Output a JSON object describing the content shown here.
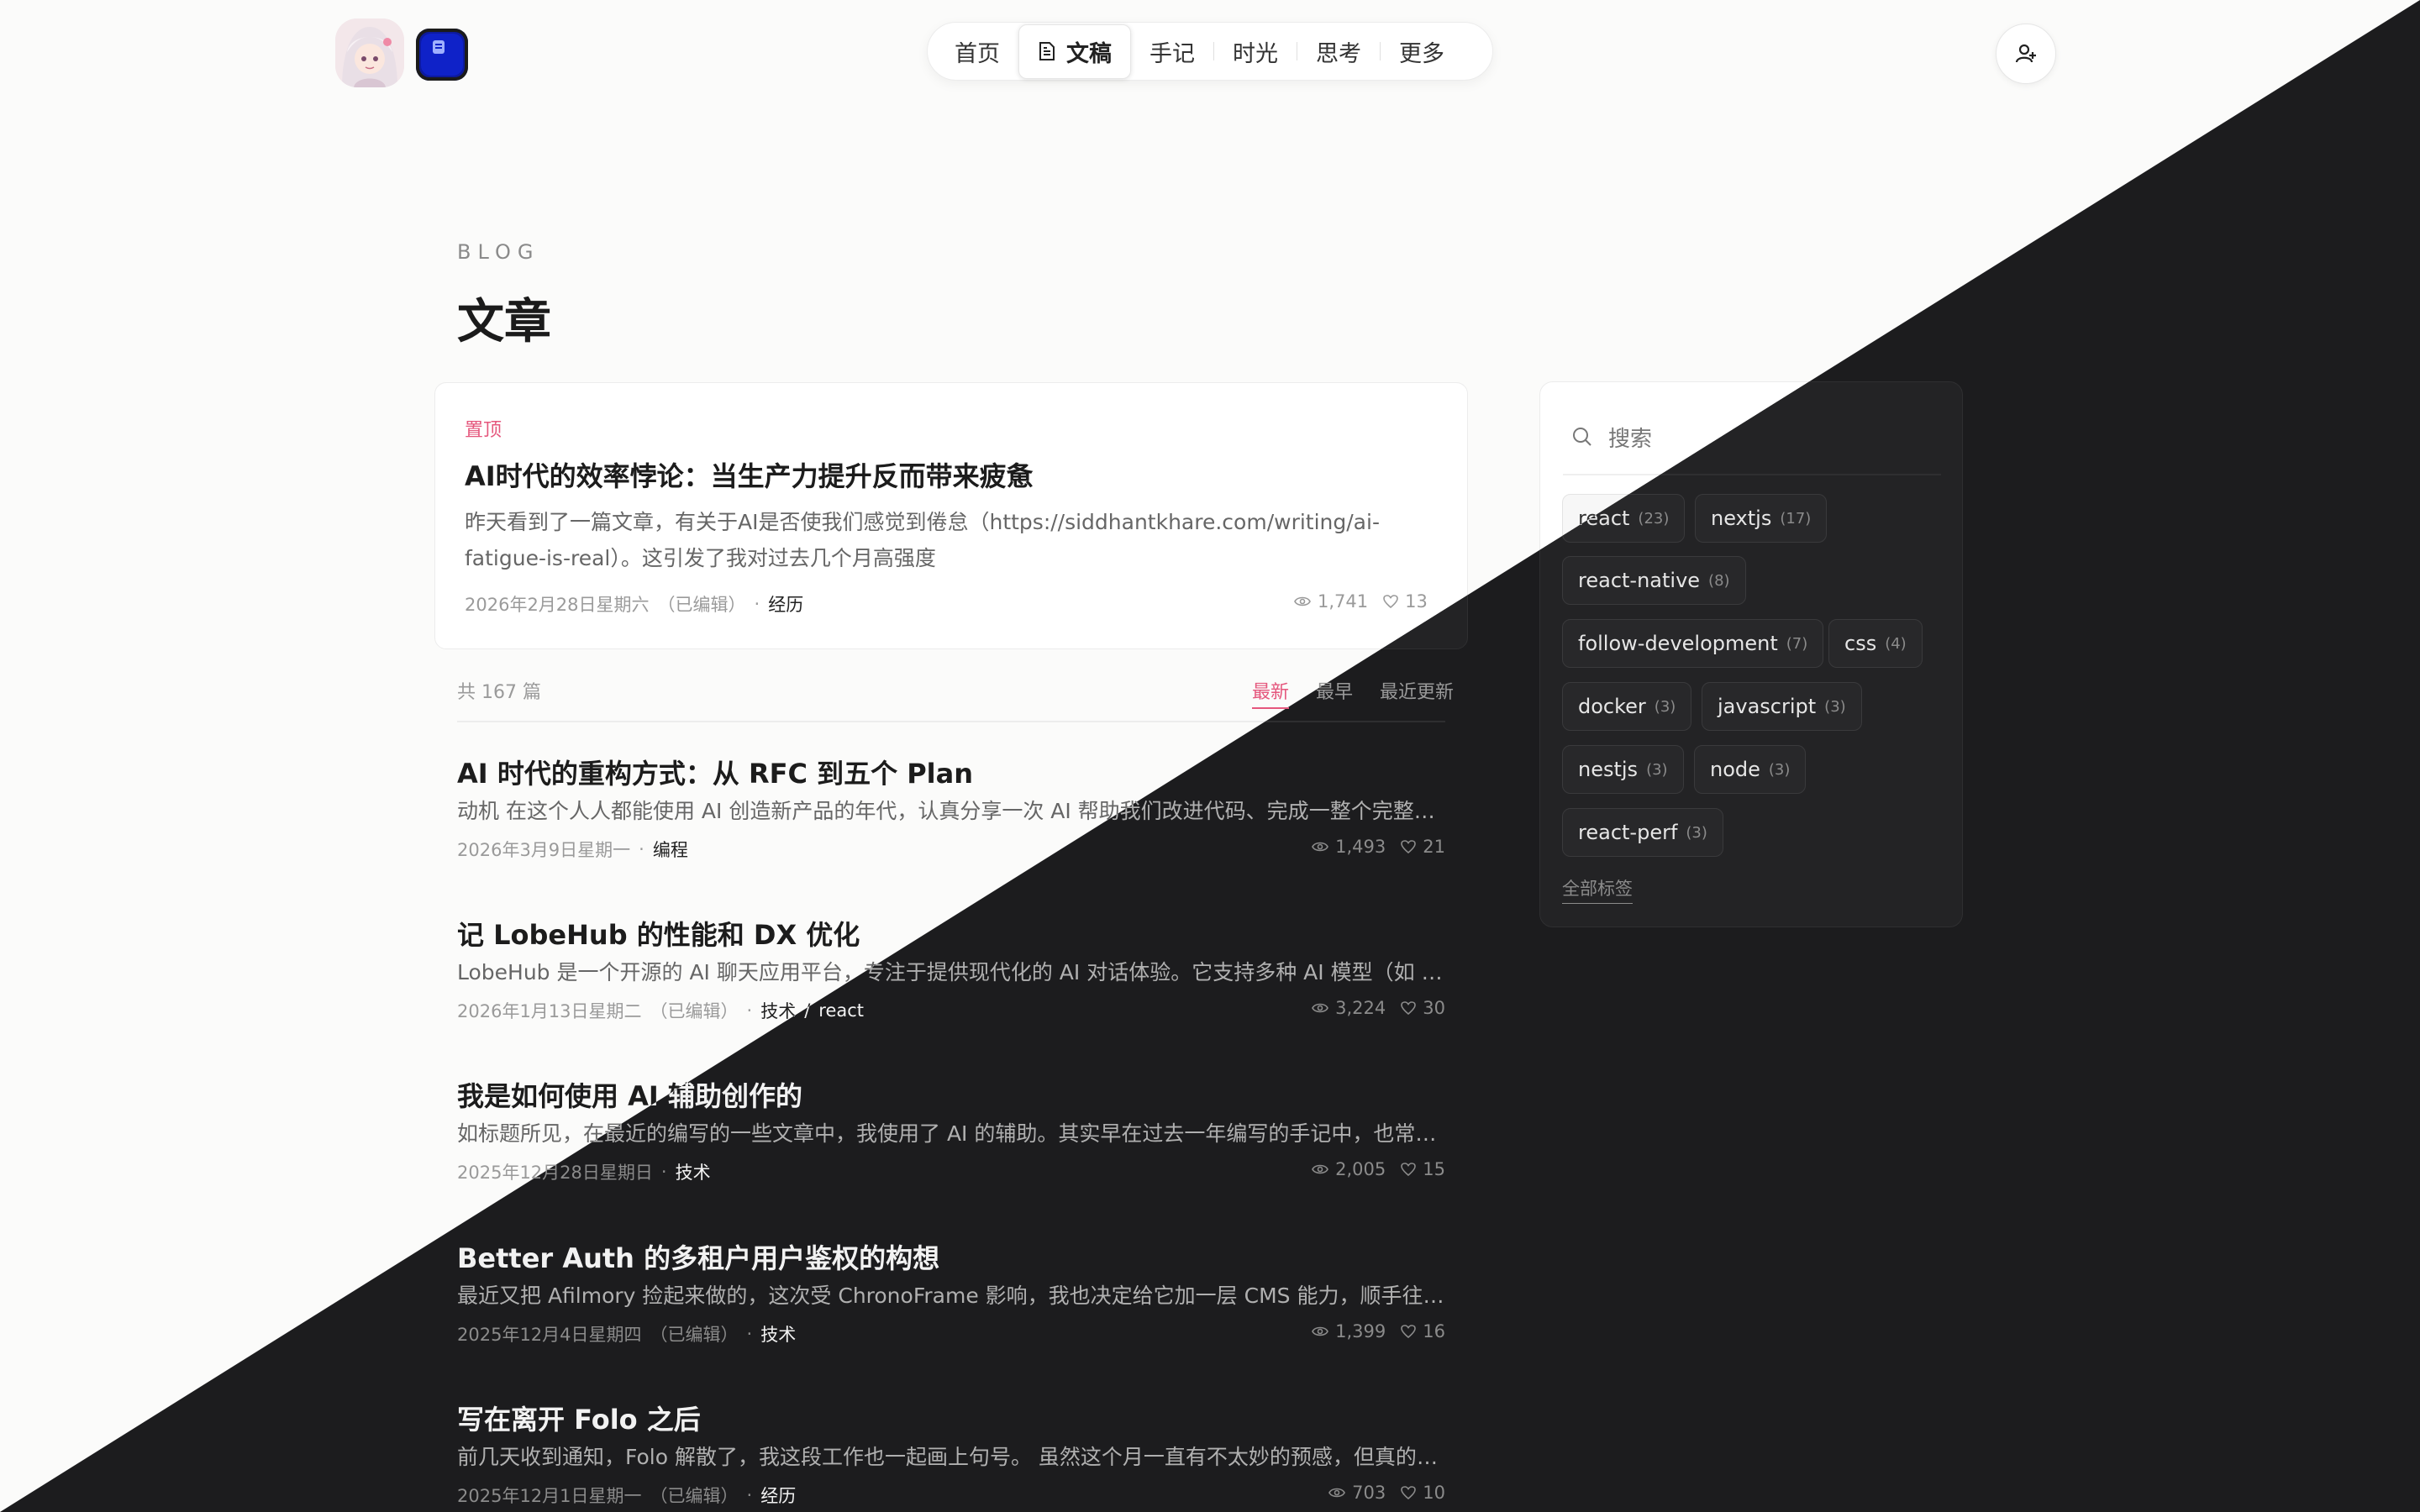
{
  "header": {
    "nav": [
      {
        "label": "首页",
        "active": false
      },
      {
        "label": "文稿",
        "active": true
      },
      {
        "label": "手记",
        "active": false
      },
      {
        "label": "时光",
        "active": false
      },
      {
        "label": "思考",
        "active": false
      },
      {
        "label": "更多",
        "active": false
      }
    ]
  },
  "page": {
    "kicker": "BLOG",
    "title": "文章"
  },
  "pinned": {
    "label": "置顶",
    "title": "AI时代的效率悖论：当生产力提升反而带来疲惫",
    "excerpt": "昨天看到了一篇文章，有关于AI是否使我们感觉到倦怠（https://siddhantkhare.com/writing/ai-fatigue-is-real）。这引发了我对过去几个月高强度",
    "date": "2026年2月28日星期六",
    "edited": "（已编辑）",
    "category": "经历",
    "views": "1,741",
    "likes": "13"
  },
  "list": {
    "count_label": "共 167 篇",
    "sort_tabs": [
      "最新",
      "最早",
      "最近更新"
    ],
    "sort_active": "最新"
  },
  "posts": [
    {
      "title": "AI 时代的重构方式：从 RFC 到五个 Plan",
      "excerpt": "动机 在这个人人都能使用 AI 创造新产品的年代，认真分享一次 AI 帮助我们改进代码、完成一整个完整重…",
      "date": "2026年3月9日星期一",
      "edited": "",
      "category": "编程",
      "subcategory": "",
      "views": "1,493",
      "likes": "21"
    },
    {
      "title": "记 LobeHub 的性能和 DX 优化",
      "excerpt": "LobeHub 是一个开源的 AI 聊天应用平台，专注于提供现代化的 AI 对话体验。它支持多种 AI 模型（如 Op…",
      "date": "2026年1月13日星期二",
      "edited": "（已编辑）",
      "category": "技术",
      "subcategory": "react",
      "views": "3,224",
      "likes": "30"
    },
    {
      "title": "我是如何使用 AI 辅助创作的",
      "excerpt": "如标题所见，在最近的编写的一些文章中，我使用了 AI 的辅助。其实早在过去一年编写的手记中，也常规…",
      "date": "2025年12月28日星期日",
      "edited": "",
      "category": "技术",
      "subcategory": "",
      "views": "2,005",
      "likes": "15"
    },
    {
      "title": "Better Auth 的多租户用户鉴权的构想",
      "excerpt": "最近又把 Afilmory 捡起来做的，这次受 ChronoFrame 影响，我也决定给它加一层 CMS 能力，顺手往「…",
      "date": "2025年12月4日星期四",
      "edited": "（已编辑）",
      "category": "技术",
      "subcategory": "",
      "views": "1,399",
      "likes": "16"
    },
    {
      "title": "写在离开 Folo 之后",
      "excerpt": "前几天收到通知，Folo 解散了，我这段工作也一起画上句号。 虽然这个月一直有不太妙的预感，但真的落…",
      "date": "2025年12月1日星期一",
      "edited": "（已编辑）",
      "category": "经历",
      "subcategory": "",
      "views": "703",
      "likes": "10"
    }
  ],
  "sidebar": {
    "search_placeholder": "搜索",
    "tags": [
      {
        "name": "react",
        "count": "(23)"
      },
      {
        "name": "nextjs",
        "count": "(17)"
      },
      {
        "name": "react-native",
        "count": "(8)"
      },
      {
        "name": "follow-development",
        "count": "(7)"
      },
      {
        "name": "css",
        "count": "(4)"
      },
      {
        "name": "docker",
        "count": "(3)"
      },
      {
        "name": "javascript",
        "count": "(3)"
      },
      {
        "name": "nestjs",
        "count": "(3)"
      },
      {
        "name": "node",
        "count": "(3)"
      },
      {
        "name": "react-perf",
        "count": "(3)"
      }
    ],
    "all_tags_label": "全部标签"
  },
  "colors": {
    "accent": "#e5577d",
    "light_bg": "#fbfbfa",
    "dark_bg": "#1c1c1e"
  },
  "icons": {
    "nav_active": "document-icon",
    "login": "user-plus-icon",
    "views": "eye-icon",
    "likes": "heart-icon",
    "search": "search-icon"
  }
}
